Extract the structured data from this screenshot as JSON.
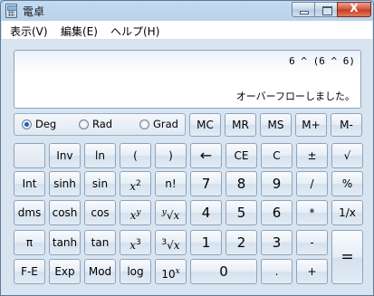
{
  "window": {
    "title": "電卓",
    "icon": "calculator-icon",
    "controls": {
      "minimize_icon": "minimize-icon",
      "maximize_icon": "maximize-icon",
      "close_label": "X"
    }
  },
  "menu": {
    "items": [
      {
        "label": "表示(V)"
      },
      {
        "label": "編集(E)"
      },
      {
        "label": "ヘルプ(H)"
      }
    ]
  },
  "display": {
    "expression": "6 ^ (6 ^ 6)",
    "result": "オーバーフローしました。"
  },
  "angle_units": {
    "selected": "Deg",
    "options": [
      "Deg",
      "Rad",
      "Grad"
    ]
  },
  "memory": [
    "MC",
    "MR",
    "MS",
    "M+",
    "M-"
  ],
  "buttons": {
    "row1": [
      "",
      "Inv",
      "ln",
      "(",
      ")",
      "←",
      "CE",
      "C",
      "±",
      "√"
    ],
    "row2_text": [
      "Int",
      "sinh",
      "sin",
      "x",
      "n!",
      "7",
      "8",
      "9",
      "/",
      "%"
    ],
    "row3_text": [
      "dms",
      "cosh",
      "cos",
      "x",
      "∛x",
      "4",
      "5",
      "6",
      "*",
      "1/x"
    ],
    "row4_text": [
      "π",
      "tanh",
      "tan",
      "x",
      "∛x",
      "1",
      "2",
      "3",
      "-",
      "="
    ],
    "row5_text": [
      "F-E",
      "Exp",
      "Mod",
      "log",
      "10",
      "0",
      ".",
      "+"
    ],
    "superscripts": {
      "x_squared": "2",
      "x_pow_y": "y",
      "x_cubed": "3",
      "ten_pow": "x",
      "root_y": "y",
      "root_3": "3"
    },
    "root_y_label": "x",
    "root_3_label": "x",
    "one_over_x": "1/x"
  },
  "colors": {
    "titlebar": "#b9d1ea",
    "window_body": "#d9e4f1",
    "close_button": "#c43a22",
    "radio_selected": "#1d5fc2"
  }
}
